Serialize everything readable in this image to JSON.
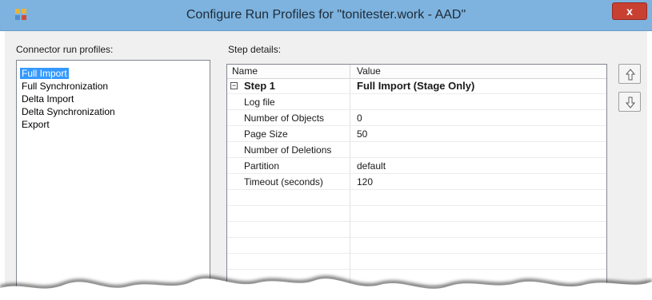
{
  "window": {
    "title": "Configure Run Profiles for \"tonitester.work - AAD\"",
    "close_label": "x"
  },
  "profiles": {
    "label": "Connector run profiles:",
    "items": [
      "Full Import",
      "Full Synchronization",
      "Delta Import",
      "Delta Synchronization",
      "Export"
    ],
    "selected": "Full Import"
  },
  "details": {
    "label": "Step details:",
    "columns": {
      "name": "Name",
      "value": "Value"
    },
    "step": {
      "name": "Step 1",
      "value": "Full Import (Stage Only)",
      "expander": "−"
    },
    "rows": [
      {
        "name": "Log file",
        "value": ""
      },
      {
        "name": "Number of Objects",
        "value": "0"
      },
      {
        "name": "Page Size",
        "value": "50"
      },
      {
        "name": "Number of Deletions",
        "value": ""
      },
      {
        "name": "Partition",
        "value": "default"
      },
      {
        "name": "Timeout (seconds)",
        "value": "120"
      }
    ]
  },
  "buttons": {
    "move_up_icon": "arrow-up-icon",
    "move_down_icon": "arrow-down-icon"
  }
}
